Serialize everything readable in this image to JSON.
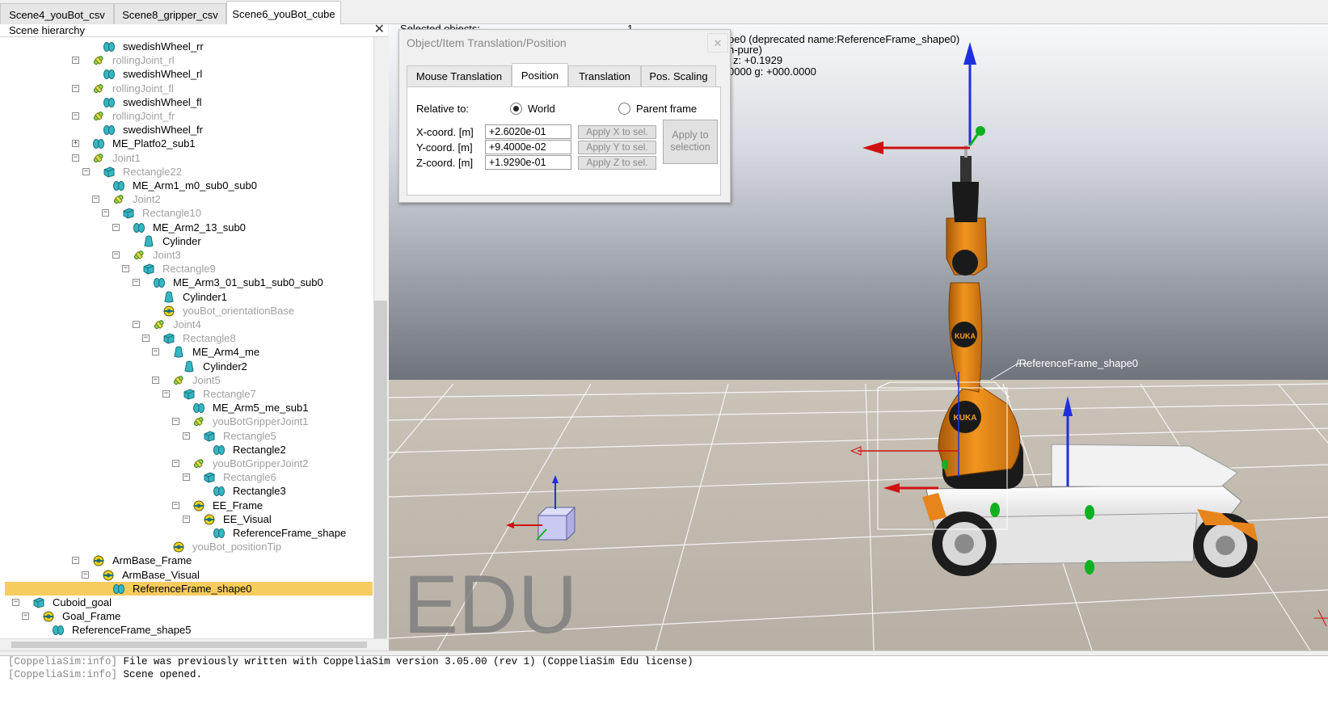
{
  "tabs": [
    {
      "label": "Scene4_youBot_csv",
      "active": false
    },
    {
      "label": "Scene8_gripper_csv",
      "active": false
    },
    {
      "label": "Scene6_youBot_cube",
      "active": true
    }
  ],
  "hierarchy": {
    "title": "Scene hierarchy",
    "close_glyph": "✕",
    "rows": [
      {
        "label": "swedishWheel_rr",
        "icon": "shape",
        "dim": false,
        "expander": ""
      },
      {
        "label": "rollingJoint_rl",
        "icon": "joint",
        "dim": true,
        "expander": "−"
      },
      {
        "label": "swedishWheel_rl",
        "icon": "shape",
        "dim": false,
        "expander": ""
      },
      {
        "label": "rollingJoint_fl",
        "icon": "joint",
        "dim": true,
        "expander": "−"
      },
      {
        "label": "swedishWheel_fl",
        "icon": "shape",
        "dim": false,
        "expander": ""
      },
      {
        "label": "rollingJoint_fr",
        "icon": "joint",
        "dim": true,
        "expander": "−"
      },
      {
        "label": "swedishWheel_fr",
        "icon": "shape",
        "dim": false,
        "expander": ""
      },
      {
        "label": "ME_Platfo2_sub1",
        "icon": "shape",
        "dim": false,
        "expander": "+"
      },
      {
        "label": "Joint1",
        "icon": "joint",
        "dim": true,
        "expander": "−"
      },
      {
        "label": "Rectangle22",
        "icon": "cuboid",
        "dim": true,
        "expander": "−"
      },
      {
        "label": "ME_Arm1_m0_sub0_sub0",
        "icon": "shape",
        "dim": false,
        "expander": ""
      },
      {
        "label": "Joint2",
        "icon": "joint",
        "dim": true,
        "expander": "−"
      },
      {
        "label": "Rectangle10",
        "icon": "cuboid",
        "dim": true,
        "expander": "−"
      },
      {
        "label": "ME_Arm2_13_sub0",
        "icon": "shape",
        "dim": false,
        "expander": "−"
      },
      {
        "label": "Cylinder",
        "icon": "cylinder",
        "dim": false,
        "expander": ""
      },
      {
        "label": "Joint3",
        "icon": "joint",
        "dim": true,
        "expander": "−"
      },
      {
        "label": "Rectangle9",
        "icon": "cuboid",
        "dim": true,
        "expander": "−"
      },
      {
        "label": "ME_Arm3_01_sub1_sub0_sub0",
        "icon": "shape",
        "dim": false,
        "expander": "−"
      },
      {
        "label": "Cylinder1",
        "icon": "cylinder",
        "dim": false,
        "expander": ""
      },
      {
        "label": "youBot_orientationBase",
        "icon": "dummy",
        "dim": true,
        "expander": ""
      },
      {
        "label": "Joint4",
        "icon": "joint",
        "dim": true,
        "expander": "−"
      },
      {
        "label": "Rectangle8",
        "icon": "cuboid",
        "dim": true,
        "expander": "−"
      },
      {
        "label": "ME_Arm4_me",
        "icon": "cylinder",
        "dim": false,
        "expander": "−"
      },
      {
        "label": "Cylinder2",
        "icon": "cylinder",
        "dim": false,
        "expander": ""
      },
      {
        "label": "Joint5",
        "icon": "joint",
        "dim": true,
        "expander": "−"
      },
      {
        "label": "Rectangle7",
        "icon": "cuboid",
        "dim": true,
        "expander": "−"
      },
      {
        "label": "ME_Arm5_me_sub1",
        "icon": "shape",
        "dim": false,
        "expander": ""
      },
      {
        "label": "youBotGripperJoint1",
        "icon": "joint",
        "dim": true,
        "expander": "−"
      },
      {
        "label": "Rectangle5",
        "icon": "cuboid",
        "dim": true,
        "expander": "−"
      },
      {
        "label": "Rectangle2",
        "icon": "shape",
        "dim": false,
        "expander": ""
      },
      {
        "label": "youBotGripperJoint2",
        "icon": "joint",
        "dim": true,
        "expander": "−"
      },
      {
        "label": "Rectangle6",
        "icon": "cuboid",
        "dim": true,
        "expander": "−"
      },
      {
        "label": "Rectangle3",
        "icon": "shape",
        "dim": false,
        "expander": ""
      },
      {
        "label": "EE_Frame",
        "icon": "dummy",
        "dim": false,
        "expander": "−"
      },
      {
        "label": "EE_Visual",
        "icon": "dummy",
        "dim": false,
        "expander": "−"
      },
      {
        "label": "ReferenceFrame_shape",
        "icon": "shape",
        "dim": false,
        "expander": ""
      },
      {
        "label": "youBot_positionTip",
        "icon": "dummy",
        "dim": true,
        "expander": ""
      },
      {
        "label": "ArmBase_Frame",
        "icon": "dummy",
        "dim": false,
        "expander": "−"
      },
      {
        "label": "ArmBase_Visual",
        "icon": "dummy",
        "dim": false,
        "expander": "−"
      },
      {
        "label": "ReferenceFrame_shape0",
        "icon": "shape",
        "dim": false,
        "expander": "",
        "selected": true
      },
      {
        "label": "Cuboid_goal",
        "icon": "cuboid",
        "dim": false,
        "expander": "−"
      },
      {
        "label": "Goal_Frame",
        "icon": "dummy",
        "dim": false,
        "expander": "−"
      },
      {
        "label": "ReferenceFrame_shape5",
        "icon": "shape",
        "dim": false,
        "expander": ""
      }
    ]
  },
  "viewport": {
    "info_line1": "Selected objects:",
    "info_line1_value": "1",
    "info_line2": "pe0   (deprecated name:ReferenceFrame_shape0)",
    "info_line3": "n-pure)",
    "info_line4": "z: +0.1929",
    "info_line5": "0000    g: +000.0000",
    "watermark": "EDU",
    "frame_label": "/ReferenceFrame_shape0",
    "arm_brand": "KUKA"
  },
  "dialog": {
    "title": "Object/Item Translation/Position",
    "close_glyph": "✕",
    "tabs": [
      {
        "label": "Mouse Translation",
        "active": false
      },
      {
        "label": "Position",
        "active": true
      },
      {
        "label": "Translation",
        "active": false
      },
      {
        "label": "Pos. Scaling",
        "active": false
      }
    ],
    "relative_to_label": "Relative to:",
    "radio_world": "World",
    "radio_parent": "Parent frame",
    "selected_reference": "World",
    "x_label": "X-coord. [m]",
    "y_label": "Y-coord. [m]",
    "z_label": "Z-coord. [m]",
    "x_value": "+2.6020e-01",
    "y_value": "+9.4000e-02",
    "z_value": "+1.9290e-01",
    "apply_x": "Apply X to sel.",
    "apply_y": "Apply Y to sel.",
    "apply_z": "Apply Z to sel.",
    "apply_selection": "Apply to selection"
  },
  "console": {
    "line1_tag": "[CoppeliaSim:info]",
    "line1_text": " File was previously written with CoppeliaSim version 3.05.00 (rev 1) (CoppeliaSim Edu license)",
    "line2_tag": "[CoppeliaSim:info]",
    "line2_text": " Scene opened."
  },
  "colors": {
    "selection": "#f6cc5e",
    "axis_x": "#d01010",
    "axis_y": "#10b020",
    "axis_z": "#1f2fe0",
    "robot_orange": "#e8841c"
  }
}
